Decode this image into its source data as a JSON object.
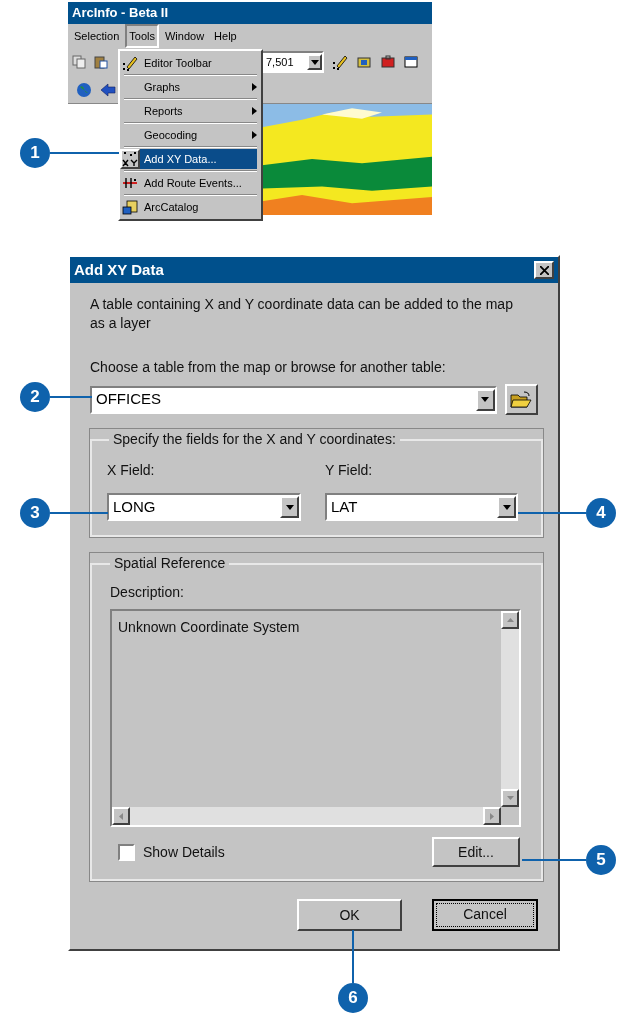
{
  "app_window": {
    "title": "ArcInfo - Beta II",
    "menu": [
      {
        "label": "Selection",
        "selected": false
      },
      {
        "label": "Tools",
        "selected": true
      },
      {
        "label": "Window",
        "selected": false
      },
      {
        "label": "Help",
        "selected": false
      }
    ],
    "scale_value": "7,501"
  },
  "tools_menu": {
    "items": [
      {
        "label": "Editor Toolbar",
        "kind": "editor",
        "submenu": false,
        "selected": false
      },
      {
        "label": "Graphs",
        "kind": "plain",
        "submenu": true,
        "selected": false
      },
      {
        "label": "Reports",
        "kind": "plain",
        "submenu": true,
        "selected": false
      },
      {
        "label": "Geocoding",
        "kind": "plain",
        "submenu": true,
        "selected": false
      },
      {
        "label": "Add XY Data...",
        "kind": "xy",
        "submenu": false,
        "selected": true
      },
      {
        "label": "Add Route Events...",
        "kind": "route",
        "submenu": false,
        "selected": false
      },
      {
        "label": "ArcCatalog",
        "kind": "catalog",
        "submenu": false,
        "selected": false
      }
    ]
  },
  "dialog": {
    "title": "Add XY Data",
    "intro": "A table containing X and Y coordinate data can be added to the map as a layer",
    "table_label": "Choose a table from the map or browse for another table:",
    "table_value": "OFFICES",
    "fields_group": "Specify the fields for the X and Y coordinates:",
    "x_label": "X Field:",
    "x_value": "LONG",
    "y_label": "Y Field:",
    "y_value": "LAT",
    "spatial_group": "Spatial Reference",
    "description_label": "Description:",
    "description": "Unknown Coordinate System",
    "show_details": {
      "label": "Show Details",
      "checked": false
    },
    "edit_button": "Edit...",
    "ok_button": "OK",
    "cancel_button": "Cancel"
  },
  "callouts": [
    "1",
    "2",
    "3",
    "4",
    "5",
    "6"
  ]
}
